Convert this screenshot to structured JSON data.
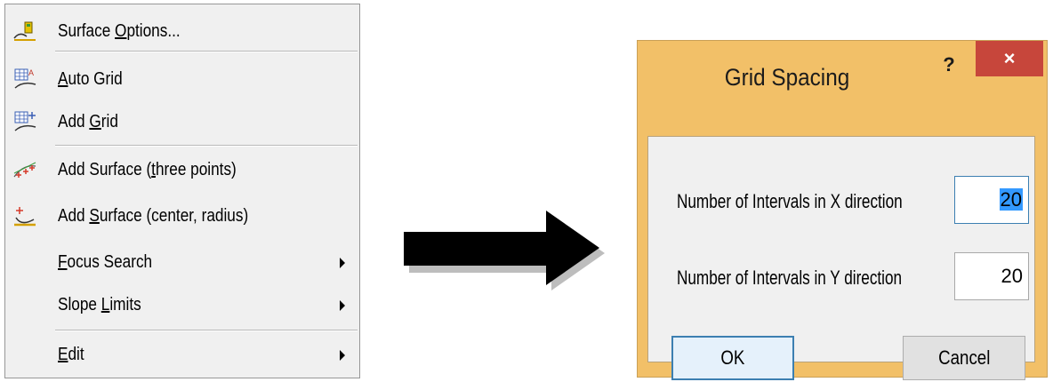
{
  "context_menu": {
    "items": [
      {
        "pre": "Surface ",
        "ul": "O",
        "post": "ptions...",
        "icon": "surface-options-icon",
        "submenu": false
      },
      {
        "pre": "",
        "ul": "A",
        "post": "uto Grid",
        "icon": "auto-grid-icon",
        "submenu": false
      },
      {
        "pre": "Add ",
        "ul": "G",
        "post": "rid",
        "icon": "add-grid-icon",
        "submenu": false
      },
      {
        "pre": "Add Surface (",
        "ul": "t",
        "post": "hree points)",
        "icon": "three-points-surface-icon",
        "submenu": false
      },
      {
        "pre": "Add ",
        "ul": "S",
        "post": "urface (center, radius)",
        "icon": "center-radius-surface-icon",
        "submenu": false
      },
      {
        "pre": "",
        "ul": "F",
        "post": "ocus Search",
        "icon": "",
        "submenu": true
      },
      {
        "pre": "Slope ",
        "ul": "L",
        "post": "imits",
        "icon": "",
        "submenu": true
      },
      {
        "pre": "",
        "ul": "E",
        "post": "dit",
        "icon": "",
        "submenu": true
      }
    ]
  },
  "dialog": {
    "title": "Grid Spacing",
    "help_label": "?",
    "close_label": "×",
    "fields": [
      {
        "label": "Number of Intervals in X direction",
        "value": "20"
      },
      {
        "label": "Number of Intervals in Y direction",
        "value": "20"
      }
    ],
    "ok_label": "OK",
    "cancel_label": "Cancel"
  },
  "colors": {
    "dialog_frame": "#f2c068",
    "close_button": "#c7463b",
    "selection": "#3399ff"
  }
}
